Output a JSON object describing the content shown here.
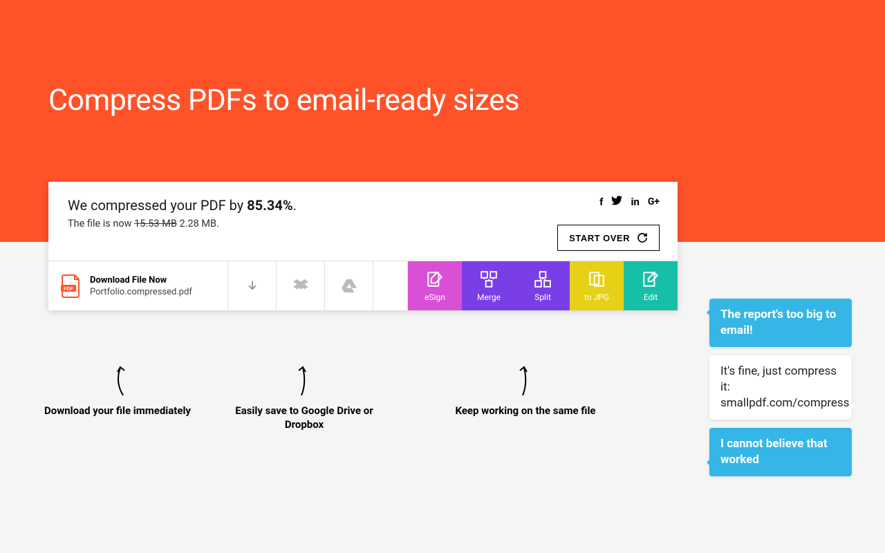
{
  "hero": {
    "title": "Compress PDFs to email-ready sizes"
  },
  "result": {
    "line_prefix": "We compressed your PDF by ",
    "percent": "85.34%",
    "line_suffix": ".",
    "size_prefix": "The file is now ",
    "old_size": "15.53 MB",
    "new_size": "2.28 MB",
    "size_suffix": "."
  },
  "start_over": "START OVER",
  "download": {
    "title": "Download File Now",
    "filename": "Portfolio.compressed.pdf"
  },
  "tools": {
    "esign": {
      "label": "eSign",
      "color": "#D94FD6"
    },
    "merge": {
      "label": "Merge",
      "color": "#7A3EE6"
    },
    "split": {
      "label": "Split",
      "color": "#7A3EE6"
    },
    "tojpg": {
      "label": "to JPG",
      "color": "#E6D117"
    },
    "edit": {
      "label": "Edit",
      "color": "#17BFA8"
    }
  },
  "annotations": {
    "download": "Download your file immediately",
    "cloud": "Easily save to Google Drive or Dropbox",
    "tools": "Keep working on the same file"
  },
  "chat": {
    "msg1": "The report's too big to email!",
    "msg2": "It's fine, just compress it: smallpdf.com/compress",
    "msg3": "I cannot believe that worked"
  }
}
